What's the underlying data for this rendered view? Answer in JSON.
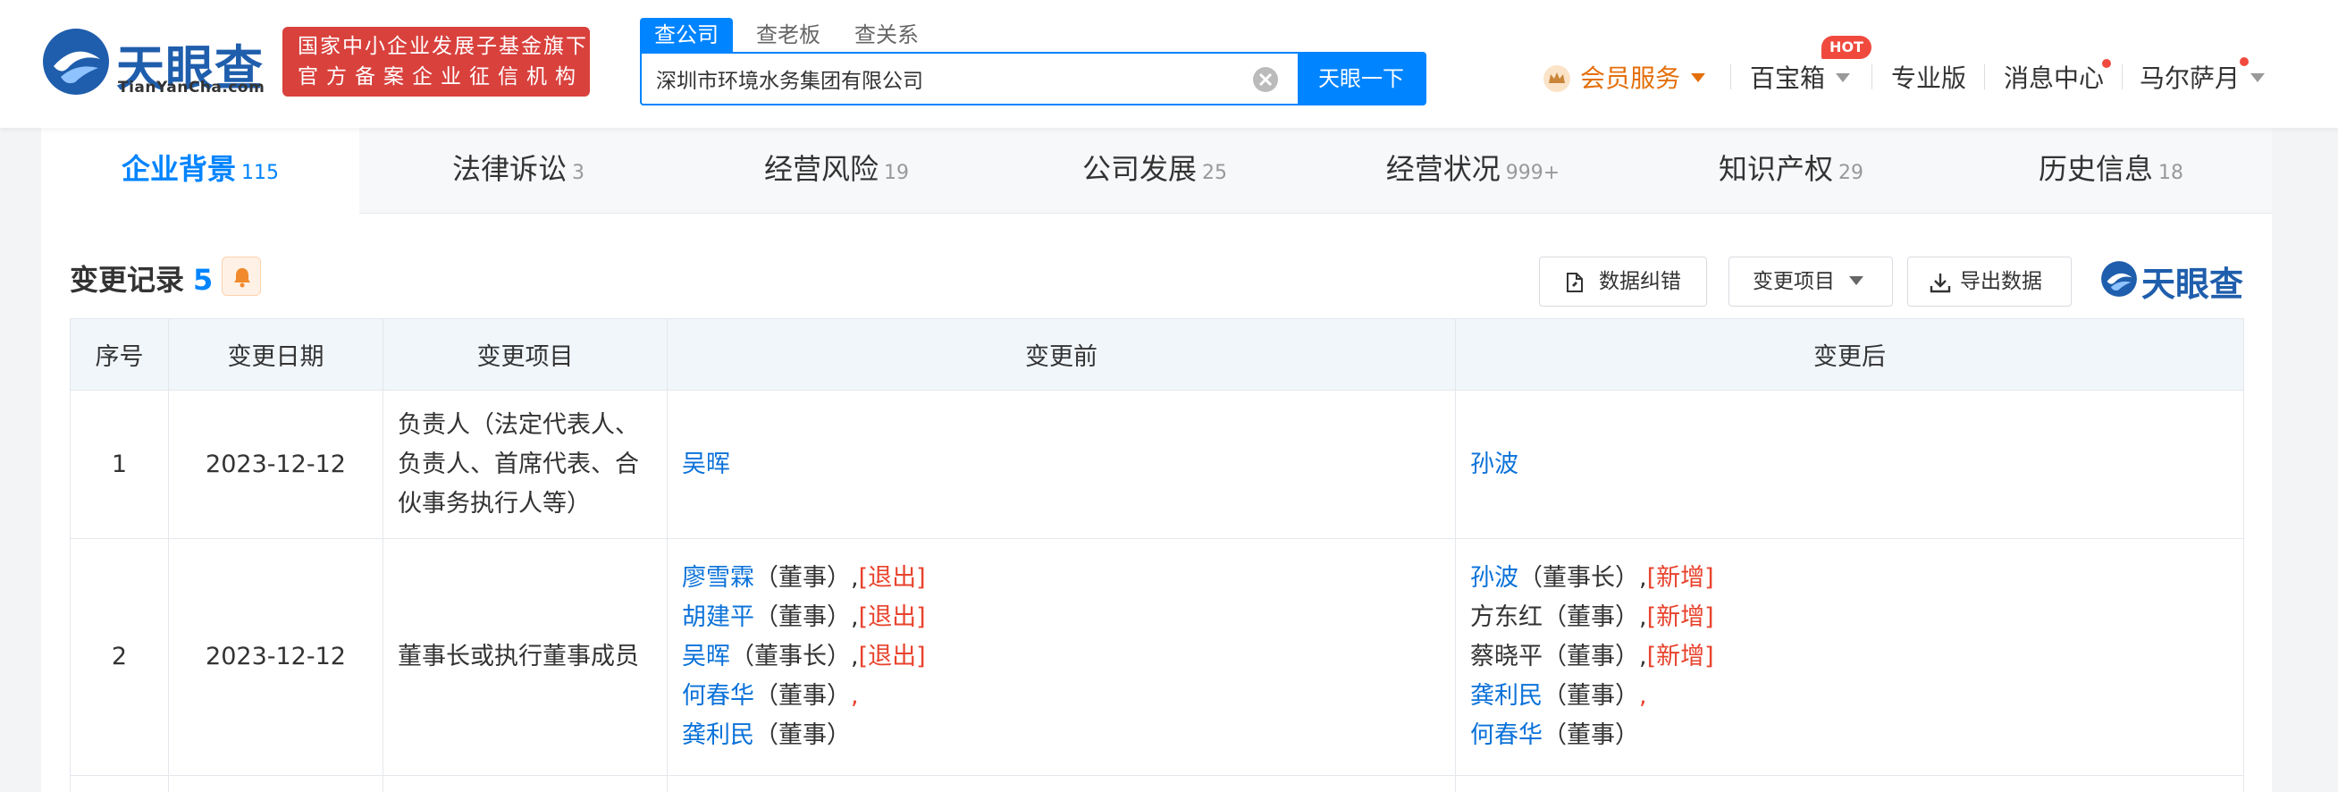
{
  "header": {
    "logo_cn": "天眼查",
    "logo_en": "TianYanCha.com",
    "slogan_line1": "国家中小企业发展子基金旗下",
    "slogan_line2": "官方备案企业征信机构",
    "search_tabs": [
      "查公司",
      "查老板",
      "查关系"
    ],
    "search_value": "深圳市环境水务集团有限公司",
    "search_button": "天眼一下",
    "nav": {
      "vip": "会员服务",
      "toolbox": "百宝箱",
      "hot_badge": "HOT",
      "pro": "专业版",
      "messages": "消息中心",
      "user": "马尔萨月"
    }
  },
  "tabs": [
    {
      "label": "企业背景",
      "count": "115"
    },
    {
      "label": "法律诉讼",
      "count": "3"
    },
    {
      "label": "经营风险",
      "count": "19"
    },
    {
      "label": "公司发展",
      "count": "25"
    },
    {
      "label": "经营状况",
      "count": "999+"
    },
    {
      "label": "知识产权",
      "count": "29"
    },
    {
      "label": "历史信息",
      "count": "18"
    }
  ],
  "section": {
    "title": "变更记录",
    "count": "5",
    "btn_correct": "数据纠错",
    "btn_filter": "变更项目",
    "btn_export": "导出数据",
    "watermark": "天眼查"
  },
  "table": {
    "headers": [
      "序号",
      "变更日期",
      "变更项目",
      "变更前",
      "变更后"
    ],
    "rows": [
      {
        "no": "1",
        "date": "2023-12-12",
        "item": "负责人（法定代表人、负责人、首席代表、合伙事务执行人等）",
        "before": "吴晖",
        "after": "孙波"
      },
      {
        "no": "2",
        "date": "2023-12-12",
        "item": "董事长或执行董事成员",
        "before": [
          {
            "name": "廖雪霖",
            "role": "（董事）",
            "sep": ",",
            "tag": "[退出]"
          },
          {
            "name": "胡建平",
            "role": "（董事）",
            "sep": ",",
            "tag": "[退出]"
          },
          {
            "name": "吴晖",
            "role": "（董事长）",
            "sep": ",",
            "tag": "[退出]"
          },
          {
            "name": "何春华",
            "role": "（董事）",
            "sep": ",",
            "tag": ""
          },
          {
            "name": "龚利民",
            "role": "（董事）",
            "sep": "",
            "tag": ""
          }
        ],
        "after": [
          {
            "name": "孙波",
            "role": "（董事长）",
            "sep": ",",
            "tag": "[新增]"
          },
          {
            "name": "方东红",
            "role": "（董事）",
            "sep": ",",
            "tag": "[新增]"
          },
          {
            "name": "蔡晓平",
            "role": "（董事）",
            "sep": ",",
            "tag": "[新增]"
          },
          {
            "name": "龚利民",
            "role": "（董事）",
            "sep": ",",
            "tag": ""
          },
          {
            "name": "何春华",
            "role": "（董事）",
            "sep": "",
            "tag": ""
          }
        ]
      }
    ]
  },
  "colors": {
    "brand_blue": "#0084ff",
    "logo_blue": "#1f5eac",
    "slogan_red": "#d9413d",
    "vip_orange": "#e46f0a",
    "tag_red": "#e8432d",
    "link_blue": "#0b72d9"
  }
}
